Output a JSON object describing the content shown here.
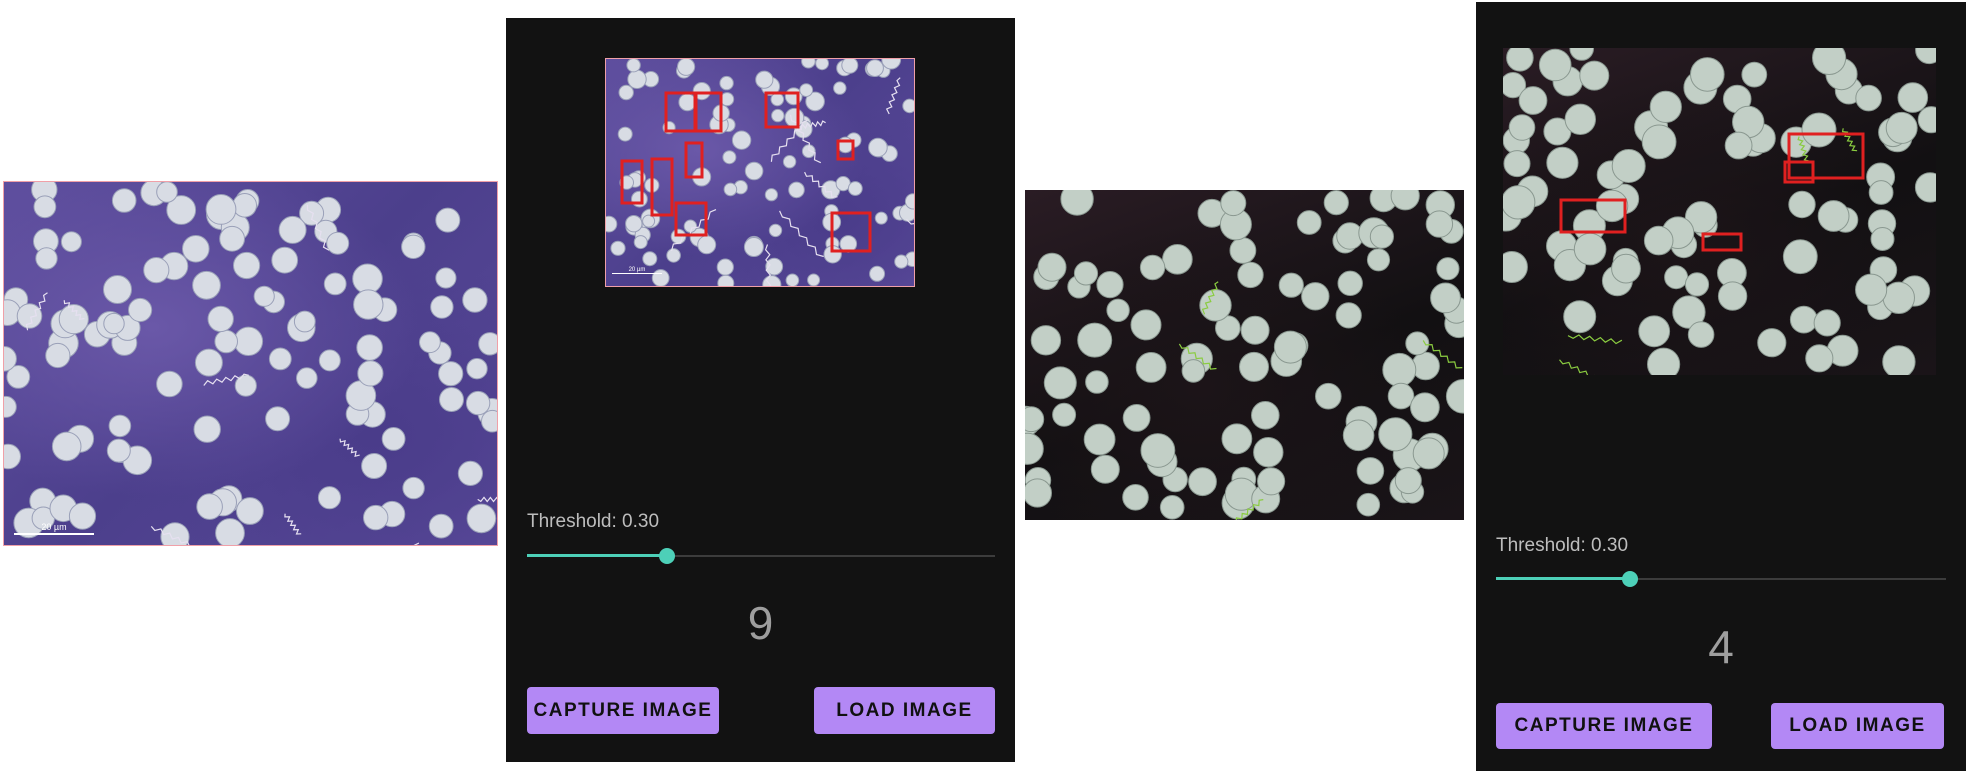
{
  "images": {
    "blood_smear_stained": {
      "scale_bar_label": "20 µm",
      "style": "purple-stained-microscopy"
    },
    "blood_smear_darkfield": {
      "style": "darkfield-microscopy"
    }
  },
  "screen_1": {
    "threshold_label": "Threshold: 0.30",
    "threshold_value": 0.3,
    "detection_count": "9",
    "preview_scale_bar_label": "20 µm",
    "capture_button": "CAPTURE IMAGE",
    "load_button": "LOAD IMAGE"
  },
  "screen_2": {
    "threshold_label": "Threshold: 0.30",
    "threshold_value": 0.3,
    "detection_count": "4",
    "capture_button": "CAPTURE IMAGE",
    "load_button": "LOAD IMAGE"
  },
  "colors": {
    "panel_background": "#121212",
    "accent": "#4dd0b8",
    "button": "#b388f5",
    "detection_box": "#e02020",
    "text_muted": "#bdbdbd"
  }
}
